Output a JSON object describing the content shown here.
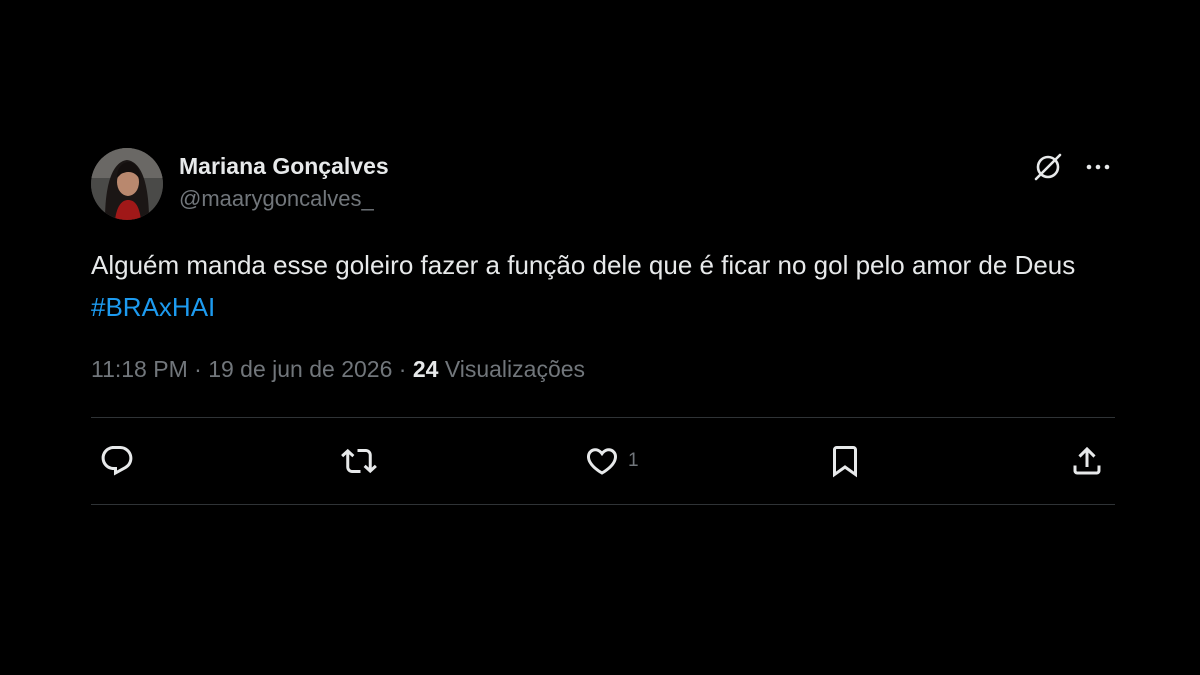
{
  "author": {
    "display_name": "Mariana Gonçalves",
    "handle": "@maarygoncalves_",
    "avatar_icon": "avatar-photo"
  },
  "header_icons": [
    "grok-icon",
    "more-options-icon"
  ],
  "tweet": {
    "text": "Alguém manda esse goleiro fazer a função dele que é ficar no gol pelo amor de Deus",
    "hashtag": "#BRAxHAI"
  },
  "meta": {
    "time": "11:18 PM",
    "separator": "·",
    "date": "19 de jun de 2026",
    "views_count": "24",
    "views_label": "Visualizações"
  },
  "actions": {
    "reply_icon": "reply-icon",
    "retweet_icon": "retweet-icon",
    "like_icon": "heart-icon",
    "like_count": "1",
    "bookmark_icon": "bookmark-icon",
    "share_icon": "share-icon"
  },
  "colors": {
    "background": "#000000",
    "text_primary": "#e7e9ea",
    "text_secondary": "#71767b",
    "link": "#1d9bf0",
    "divider": "#2f3336"
  }
}
